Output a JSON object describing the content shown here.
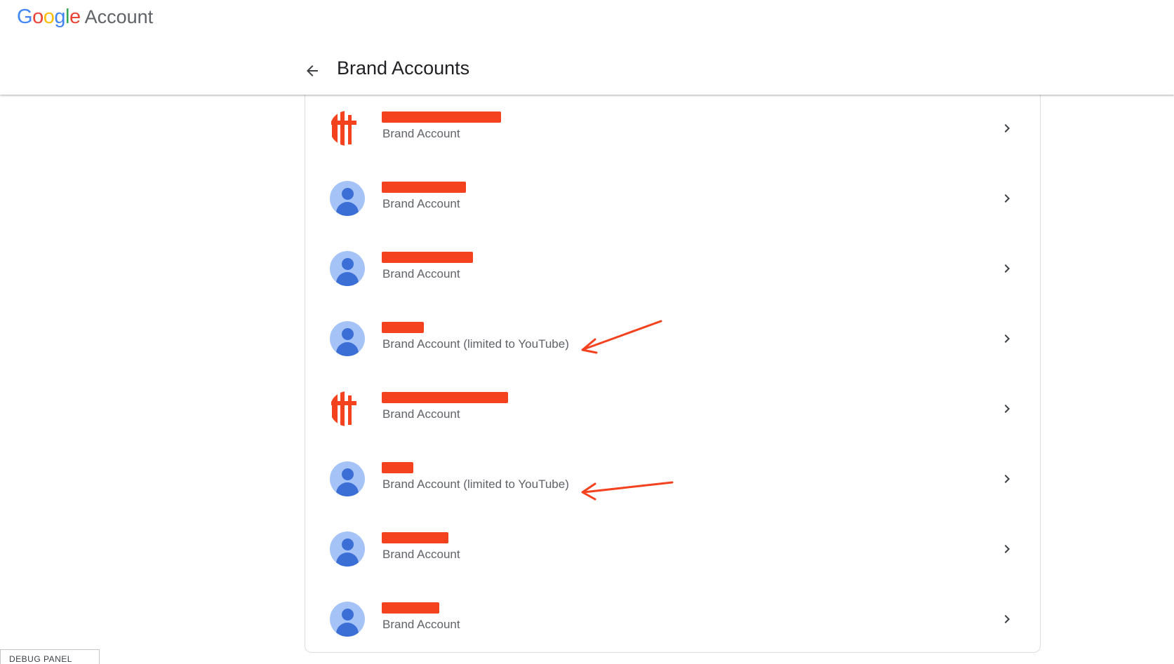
{
  "header": {
    "logo_google": "Google",
    "logo_account": "Account",
    "title": "Brand Accounts"
  },
  "accounts": [
    {
      "type": "Brand Account",
      "avatar": "redacted",
      "name_redacted": true
    },
    {
      "type": "Brand Account",
      "avatar": "default-person-icon",
      "name_redacted": true
    },
    {
      "type": "Brand Account",
      "avatar": "default-person-icon",
      "name_redacted": true
    },
    {
      "type": "Brand Account (limited to YouTube)",
      "avatar": "default-person-icon",
      "name_redacted": true
    },
    {
      "type": "Brand Account",
      "avatar": "redacted",
      "name_redacted": true
    },
    {
      "type": "Brand Account (limited to YouTube)",
      "avatar": "default-person-icon",
      "name_redacted": true
    },
    {
      "type": "Brand Account",
      "avatar": "default-person-icon",
      "name_redacted": true
    },
    {
      "type": "Brand Account",
      "avatar": "default-person-icon",
      "name_redacted": true
    }
  ],
  "debug_panel": {
    "label": "DEBUG PANEL"
  },
  "colors": {
    "google_blue": "#4285F4",
    "google_red": "#EA4335",
    "google_yellow": "#FBBC05",
    "google_green": "#34A853",
    "avatar_bg": "#a6c3f7",
    "avatar_fg": "#3b6fd6",
    "annotation_red": "#f4411e",
    "secondary_text": "#5f6368"
  },
  "icons": {
    "back": "arrow-back-icon",
    "row_chevron": "chevron-right-icon",
    "avatar": "person-icon"
  }
}
